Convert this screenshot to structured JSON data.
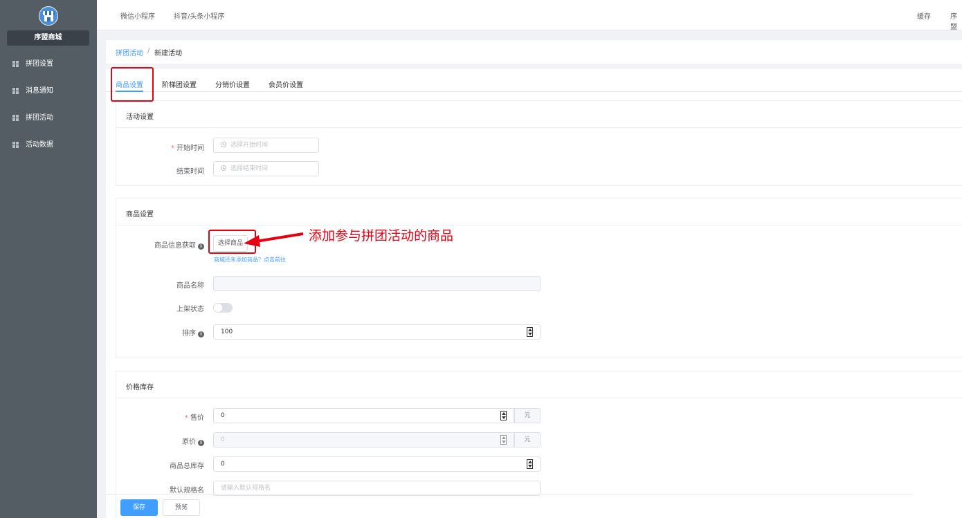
{
  "app": {
    "brand": "序盟商城"
  },
  "sidebar": {
    "items": [
      {
        "label": "拼团设置",
        "icon": "grid-icon"
      },
      {
        "label": "消息通知",
        "icon": "grid-icon"
      },
      {
        "label": "拼团活动",
        "icon": "grid-icon"
      },
      {
        "label": "活动数据",
        "icon": "grid-icon"
      }
    ]
  },
  "topbar": {
    "links": [
      "微信小程序",
      "抖音/头条小程序"
    ],
    "right": [
      "缓存",
      "序盟"
    ]
  },
  "breadcrumb": {
    "parent": "拼团活动",
    "separator": "/",
    "current": "新建活动"
  },
  "tabs": [
    "商品设置",
    "阶梯团设置",
    "分销价设置",
    "会员价设置"
  ],
  "activity": {
    "title": "活动设置",
    "start_label": "开始时间",
    "start_placeholder": "选择开始时间",
    "end_label": "结束时间",
    "end_placeholder": "选择结束时间"
  },
  "goods": {
    "title": "商品设置",
    "info_label": "商品信息获取",
    "select_button": "选择商品",
    "tip_link": "商城还未添加商品？点击前往",
    "name_label": "商品名称",
    "name_value": "",
    "status_label": "上架状态",
    "sort_label": "排序",
    "sort_value": "100"
  },
  "annotation": "添加参与拼团活动的商品",
  "price": {
    "title": "价格库存",
    "sale_label": "售价",
    "sale_value": "0",
    "sale_unit": "元",
    "orig_label": "原价",
    "orig_value": "0",
    "orig_unit": "元",
    "stock_label": "商品总库存",
    "stock_value": "0",
    "spec_label": "默认规格名",
    "spec_placeholder": "请输入默认规格名"
  },
  "footer": {
    "save": "保存",
    "preview": "预览"
  },
  "colors": {
    "primary": "#409eff",
    "sidebar": "#545c64",
    "highlight": "#e60012"
  }
}
